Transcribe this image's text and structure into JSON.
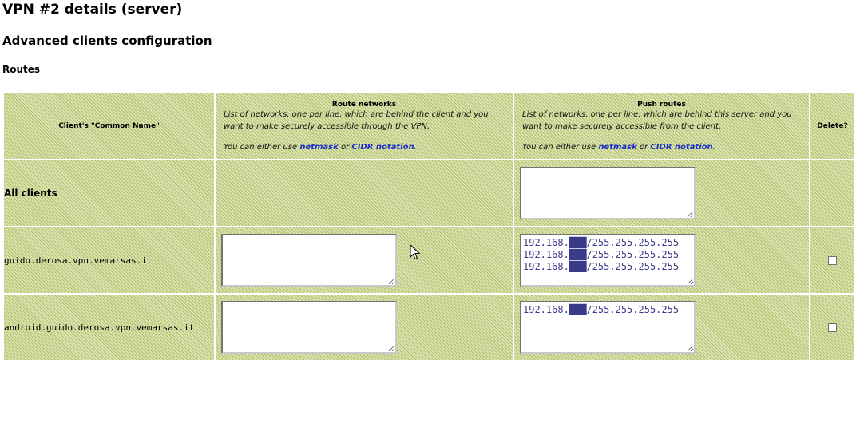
{
  "page": {
    "title": "VPN #2 details (server)",
    "subtitle": "Advanced clients configuration",
    "section": "Routes"
  },
  "table": {
    "headers": {
      "client_name": "Client's \"Common Name\"",
      "route_networks": {
        "title": "Route networks",
        "desc_line1": "List of networks, one per line, which are behind the client and you want to make securely accessible through the VPN.",
        "either_prefix": "You can either use ",
        "netmask_link": "netmask",
        "or_text": " or ",
        "cidr_link": "CIDR notation",
        "period": "."
      },
      "push_routes": {
        "title": "Push routes",
        "desc_line1": "List of networks, one per line, which are behind this server and you want to make securely accessible from the client.",
        "either_prefix": "You can either use ",
        "netmask_link": "netmask",
        "or_text": " or ",
        "cidr_link": "CIDR notation",
        "period": "."
      },
      "delete": "Delete?"
    },
    "rows": [
      {
        "name": "All clients",
        "route_networks": null,
        "push_routes": ""
      },
      {
        "name": "guido.derosa.vpn.vemarsas.it",
        "route_networks": "",
        "push_routes": "192.168.███/255.255.255.255\n192.168.███/255.255.255.255\n192.168.███/255.255.255.255",
        "delete_checked": false
      },
      {
        "name": "android.guido.derosa.vpn.vemarsas.it",
        "route_networks": "",
        "push_routes": "192.168.███/255.255.255.255",
        "delete_checked": false
      }
    ]
  },
  "colors": {
    "hatch_base": "#c7d38e",
    "link": "#1c2dc6"
  }
}
